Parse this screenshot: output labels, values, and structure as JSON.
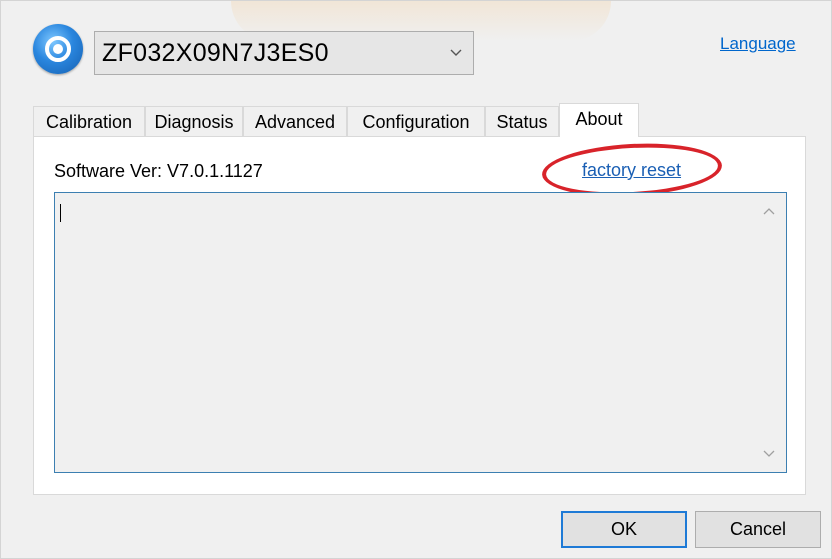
{
  "header": {
    "device_id": "ZF032X09N7J3ES0",
    "language_link": "Language"
  },
  "tabs": [
    {
      "label": "Calibration"
    },
    {
      "label": "Diagnosis"
    },
    {
      "label": "Advanced"
    },
    {
      "label": "Configuration"
    },
    {
      "label": "Status"
    },
    {
      "label": "About",
      "active": true
    }
  ],
  "about": {
    "software_version": "Software Ver: V7.0.1.1127",
    "factory_reset_link": "factory reset",
    "log_text": ""
  },
  "footer": {
    "ok_label": "OK",
    "cancel_label": "Cancel"
  },
  "colors": {
    "link": "#1a5fb4",
    "highlight_circle": "#d8232a",
    "focus_border": "#1e7ad6"
  }
}
